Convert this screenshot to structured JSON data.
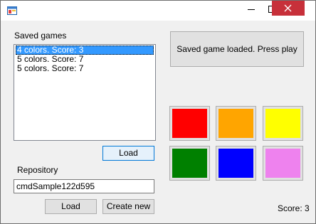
{
  "window": {
    "icon": "app-window-icon",
    "controls": {
      "minimize": "minimize-icon",
      "maximize": "maximize-icon",
      "close": "close-icon",
      "close_bg": "#c7303a"
    }
  },
  "saved_games": {
    "label": "Saved games",
    "items": [
      "4 colors. Score: 3",
      "5 colors. Score: 7",
      "5 colors. Score: 7"
    ],
    "selected_index": 0,
    "load_button": "Load"
  },
  "repository": {
    "label": "Repository",
    "value": "cmdSample122d595",
    "load_button": "Load",
    "create_button": "Create new"
  },
  "status": {
    "message": "Saved game loaded. Press play"
  },
  "colors": [
    "#ff0000",
    "#ffa500",
    "#ffff00",
    "#008000",
    "#0000ff",
    "#ee82ee"
  ],
  "score": {
    "text": "Score: 3"
  }
}
